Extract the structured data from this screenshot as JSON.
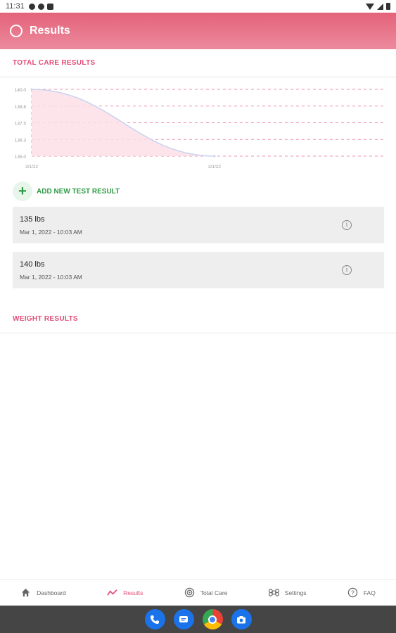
{
  "status_bar": {
    "time": "11:31"
  },
  "app_bar": {
    "title": "Results"
  },
  "sections": {
    "total_care": "TOTAL CARE RESULTS",
    "weight": "WEIGHT RESULTS"
  },
  "chart_data": {
    "type": "area",
    "y_ticks": [
      "140.0",
      "138.8",
      "137.5",
      "136.3",
      "135.0"
    ],
    "x_ticks": [
      "3/1/22",
      "3/1/22"
    ],
    "series": [
      {
        "values": [
          140,
          135
        ]
      }
    ],
    "ylim": [
      135,
      140
    ],
    "colors": {
      "fill": "#fbdfe6",
      "line": "#c9d3f3",
      "grid": "#ef93ad"
    }
  },
  "add_button": {
    "label": "ADD NEW TEST RESULT",
    "icon": "plus-icon"
  },
  "results": [
    {
      "value": "135 lbs",
      "date": "Mar 1, 2022 - 10:03 AM",
      "icon": "info-icon"
    },
    {
      "value": "140 lbs",
      "date": "Mar 1, 2022 - 10:03 AM",
      "icon": "info-icon"
    }
  ],
  "bottom_nav": [
    {
      "label": "Dashboard",
      "icon": "home-icon",
      "active": false
    },
    {
      "label": "Results",
      "icon": "trend-icon",
      "active": true
    },
    {
      "label": "Total Care",
      "icon": "target-icon",
      "active": false
    },
    {
      "label": "Settings",
      "icon": "command-icon",
      "active": false
    },
    {
      "label": "FAQ",
      "icon": "help-icon",
      "active": false
    }
  ],
  "dock": [
    "phone-icon",
    "messages-icon",
    "chrome-icon",
    "camera-icon"
  ],
  "colors": {
    "accent": "#e04e78",
    "appbar": "#e4627a",
    "green": "#2c9a43"
  }
}
